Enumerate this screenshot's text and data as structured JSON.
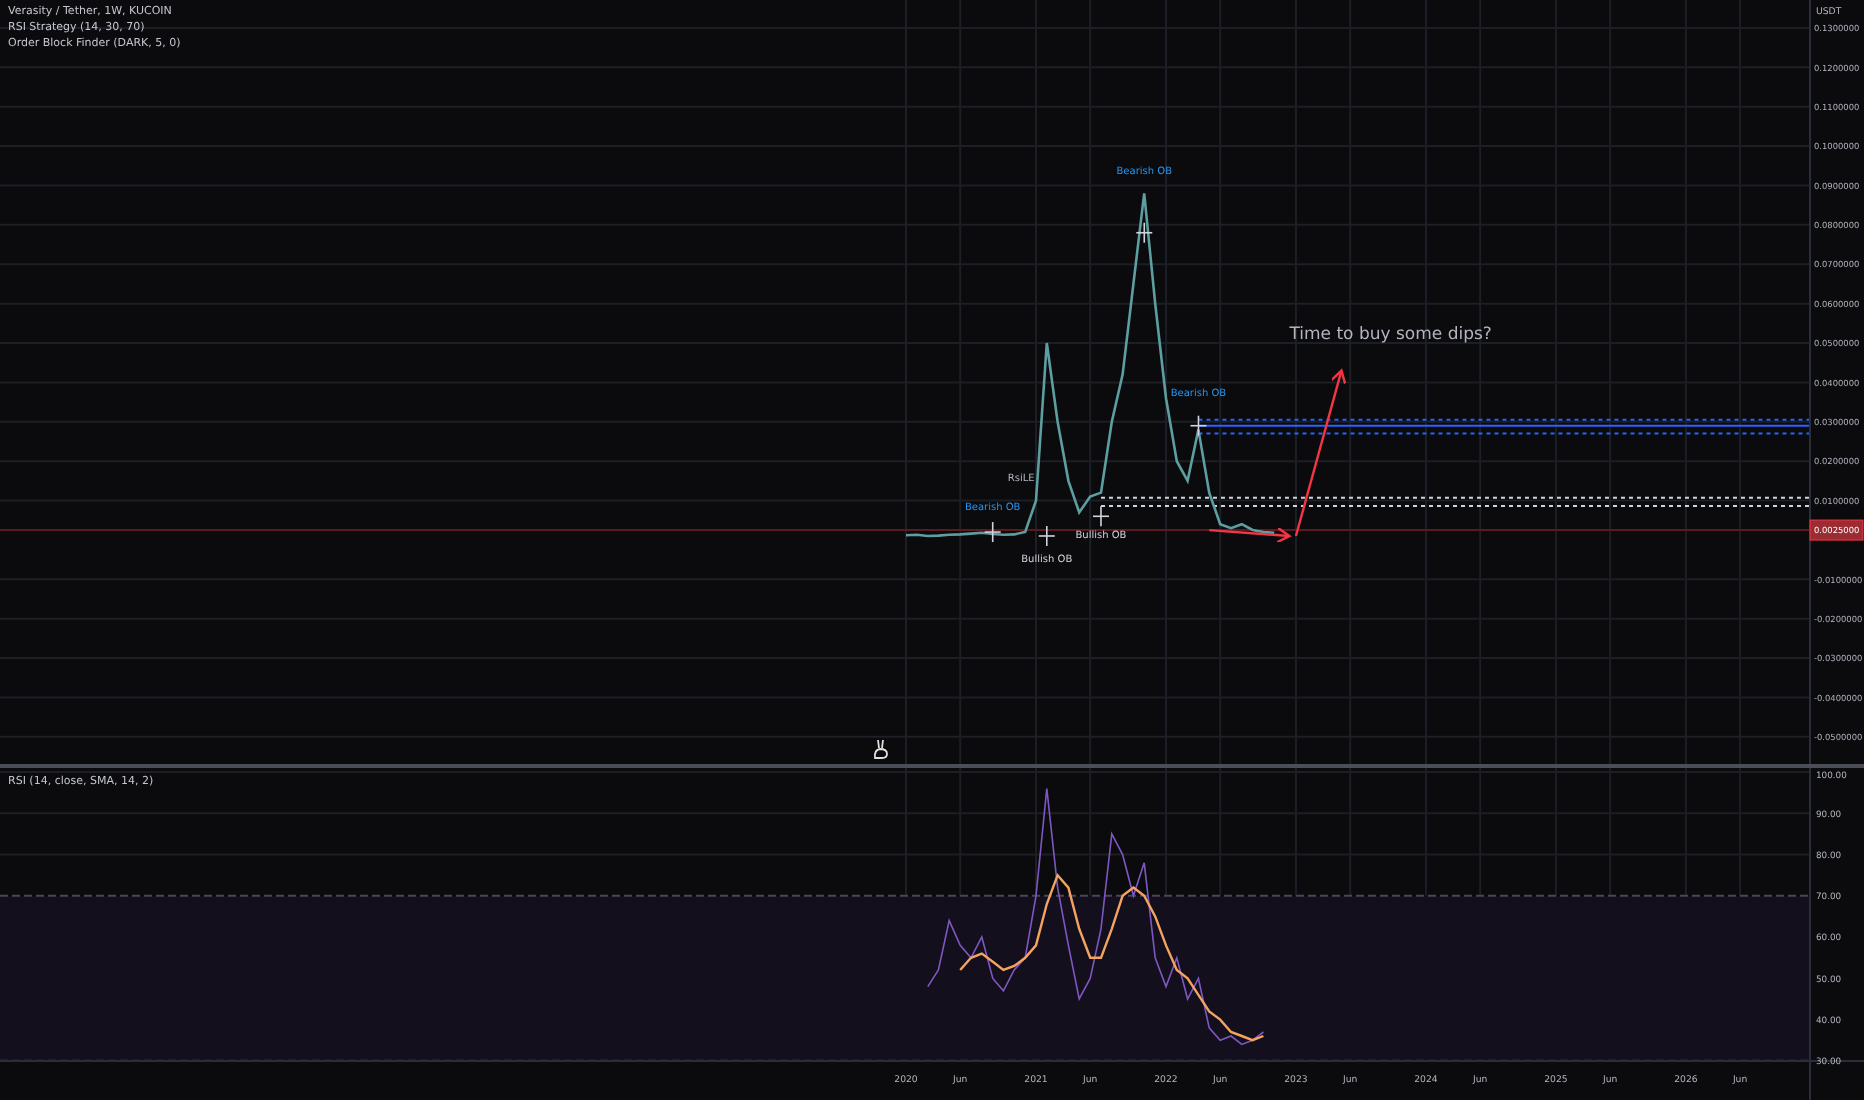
{
  "legend": [
    "Verasity / Tether, 1W, KUCOIN",
    "RSI Strategy (14, 30, 70)",
    "Order Block Finder (DARK, 5, 0)"
  ],
  "price_pane": {
    "unit": "USDT",
    "chart_data": {
      "type": "line",
      "x": [
        2020,
        2020.083,
        2020.167,
        2020.25,
        2020.333,
        2020.417,
        2020.5,
        2020.583,
        2020.667,
        2020.75,
        2020.833,
        2020.917,
        2021,
        2021.083,
        2021.167,
        2021.25,
        2021.333,
        2021.417,
        2021.5,
        2021.583,
        2021.667,
        2021.75,
        2021.833,
        2021.917,
        2022,
        2022.083,
        2022.167,
        2022.25,
        2022.333,
        2022.417,
        2022.5,
        2022.583,
        2022.667,
        2022.75,
        2022.833
      ],
      "series": [
        {
          "color": "#5d9ea0",
          "values": [
            0.0012,
            0.0013,
            0.001,
            0.0011,
            0.0013,
            0.0014,
            0.0016,
            0.0018,
            0.0015,
            0.0013,
            0.0014,
            0.002,
            0.01,
            0.05,
            0.03,
            0.015,
            0.007,
            0.011,
            0.012,
            0.03,
            0.042,
            0.065,
            0.088,
            0.06,
            0.036,
            0.02,
            0.015,
            0.028,
            0.012,
            0.004,
            0.003,
            0.004,
            0.0025,
            0.002,
            0.0018
          ]
        }
      ],
      "xlim": [
        2013.03,
        2027.37
      ],
      "ylim": [
        -0.0569,
        0.1371
      ],
      "yticks": [
        {
          "value": 0.13,
          "label": "0.1300000"
        },
        {
          "value": 0.12,
          "label": "0.1200000"
        },
        {
          "value": 0.11,
          "label": "0.1100000"
        },
        {
          "value": 0.1,
          "label": "0.1000000"
        },
        {
          "value": 0.09,
          "label": "0.0900000"
        },
        {
          "value": 0.08,
          "label": "0.0800000"
        },
        {
          "value": 0.07,
          "label": "0.0700000"
        },
        {
          "value": 0.06,
          "label": "0.0600000"
        },
        {
          "value": 0.05,
          "label": "0.0500000"
        },
        {
          "value": 0.04,
          "label": "0.0400000"
        },
        {
          "value": 0.03,
          "label": "0.0300000"
        },
        {
          "value": 0.02,
          "label": "0.0200000"
        },
        {
          "value": 0.01,
          "label": "0.0100000"
        },
        {
          "value": -0.01,
          "label": "-0.0100000"
        },
        {
          "value": -0.02,
          "label": "-0.0200000"
        },
        {
          "value": -0.03,
          "label": "-0.0300000"
        },
        {
          "value": -0.04,
          "label": "-0.0400000"
        },
        {
          "value": -0.05,
          "label": "-0.0500000"
        }
      ],
      "grid": true,
      "ref_lines": [
        {
          "axis": "y",
          "value": 0.0025,
          "label": "0.0025000",
          "color": "#5a1a1e"
        },
        {
          "axis": "y",
          "value": 0.0305,
          "color": "#2962ff"
        },
        {
          "axis": "y",
          "value": 0.029,
          "color": "#2962ff"
        },
        {
          "axis": "y",
          "value": 0.027,
          "color": "#2962ff"
        },
        {
          "axis": "y",
          "value": 0.0107,
          "color": "#d1d4dc"
        },
        {
          "axis": "y",
          "value": 0.0086,
          "color": "#d1d4dc"
        }
      ],
      "annotations": [
        "Bearish OB",
        "Bullish OB",
        "RsiLE",
        "Bullish OB",
        "Bearish OB",
        "Bearish OB",
        "Time to buy some dips?"
      ]
    }
  },
  "rsi_pane": {
    "legend": "RSI (14, close, SMA, 14, 2)",
    "chart_data": {
      "type": "line",
      "x": [
        2020.167,
        2020.25,
        2020.333,
        2020.417,
        2020.5,
        2020.583,
        2020.667,
        2020.75,
        2020.833,
        2020.917,
        2021,
        2021.083,
        2021.167,
        2021.25,
        2021.333,
        2021.417,
        2021.5,
        2021.583,
        2021.667,
        2021.75,
        2021.833,
        2021.917,
        2022,
        2022.083,
        2022.167,
        2022.25,
        2022.333,
        2022.417,
        2022.5,
        2022.583,
        2022.667,
        2022.75
      ],
      "series": [
        {
          "color": "#7e57c2",
          "values": [
            48,
            52,
            64,
            58,
            55,
            60,
            50,
            47,
            52,
            55,
            70,
            96,
            72,
            58,
            45,
            50,
            62,
            85,
            80,
            70,
            78,
            55,
            48,
            55,
            45,
            50,
            38,
            35,
            36,
            34,
            35,
            37
          ]
        },
        {
          "color": "#f4a460",
          "values": [
            null,
            null,
            null,
            52,
            55,
            56,
            54,
            52,
            53,
            55,
            58,
            68,
            75,
            72,
            62,
            55,
            55,
            62,
            70,
            72,
            70,
            65,
            58,
            52,
            50,
            46,
            42,
            40,
            37,
            36,
            35,
            36
          ]
        }
      ],
      "xlim": [
        2013.03,
        2027.37
      ],
      "ylim": [
        20.5,
        101
      ],
      "yticks": [
        {
          "value": 100,
          "label": "100.00"
        },
        {
          "value": 90,
          "label": "90.00"
        },
        {
          "value": 80,
          "label": "80.00"
        },
        {
          "value": 70,
          "label": "70.00"
        },
        {
          "value": 60,
          "label": "60.00"
        },
        {
          "value": 50,
          "label": "50.00"
        },
        {
          "value": 40,
          "label": "40.00"
        },
        {
          "value": 30,
          "label": "30.00"
        }
      ],
      "xticks": [
        {
          "value": 2020,
          "label": "2020"
        },
        {
          "value": 2020.417,
          "label": "Jun"
        },
        {
          "value": 2021,
          "label": "2021"
        },
        {
          "value": 2021.417,
          "label": "Jun"
        },
        {
          "value": 2022,
          "label": "2022"
        },
        {
          "value": 2022.417,
          "label": "Jun"
        },
        {
          "value": 2023,
          "label": "2023"
        },
        {
          "value": 2023.417,
          "label": "Jun"
        },
        {
          "value": 2024,
          "label": "2024"
        },
        {
          "value": 2024.417,
          "label": "Jun"
        },
        {
          "value": 2025,
          "label": "2025"
        },
        {
          "value": 2025.417,
          "label": "Jun"
        },
        {
          "value": 2026,
          "label": "2026"
        },
        {
          "value": 2026.417,
          "label": "Jun"
        }
      ],
      "grid": true,
      "bands": [
        {
          "axis": "y",
          "from": 30,
          "to": 70,
          "color": "#130f1c"
        }
      ]
    }
  }
}
